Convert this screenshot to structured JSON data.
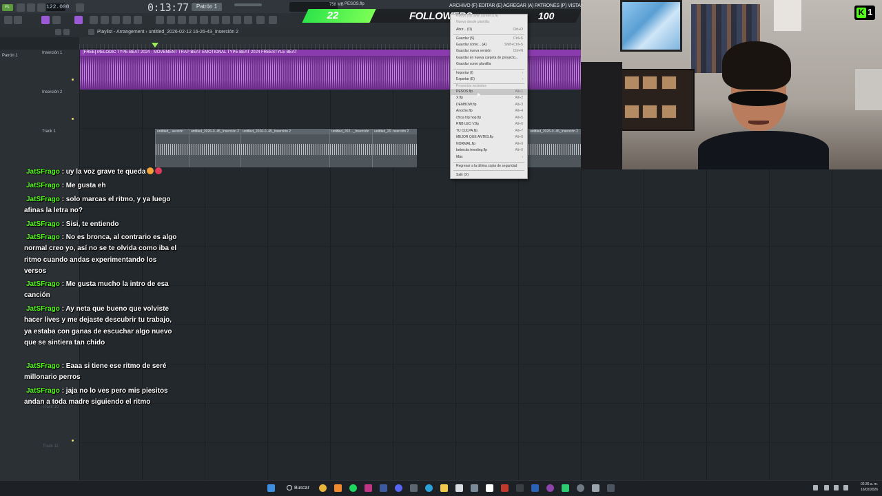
{
  "daw": {
    "bpm": "122.000",
    "time": "0:13:77",
    "pattern": "Patrón 1",
    "project_file": "PESOS.flp",
    "mem": "758 MB",
    "menubar": "ARCHIVO (F) EDITAR (E) AGREGAR (A) PATRONES (P) VISTA (V) OPCIONES (",
    "playlist_title": "Playlist - Arrangement › untitled_2026-02-12 16-26-43_Inserción 2",
    "pattern_picker": "Patrón 1"
  },
  "tracks": [
    {
      "label": "Inserción 1"
    },
    {
      "label": "Inserción 2"
    },
    {
      "label": "Track 1"
    }
  ],
  "ghost_tracks": [
    "Track 10",
    "Track 11"
  ],
  "clips": {
    "purple_title": "[FREE] MELODIC TYPE BEAT 2024 - MOVEMENT TRAP BEAT EMOTIONAL TYPE BEAT 2024 FREESTYLE BEAT",
    "gray": [
      "untitled_..serción",
      "untitled_2026-0..45_Inserción 2",
      "untitled_2026-0..45_Inserción 2",
      "untitled_202..._Inserción",
      "untitled_20..nserción 2",
      "untitled_2026-0..45_Inserción 2"
    ]
  },
  "overlay": {
    "followers_count": "22",
    "followers_label": "FOLLOWERS",
    "followers_goal": "100",
    "kick_count": "1",
    "colors": {
      "bar": "#2ee44a",
      "username": "#53fc18"
    }
  },
  "file_menu": {
    "items": [
      {
        "label": "Nuevo (N) (with screen) (N)",
        "shortcut": "",
        "dim": true
      },
      {
        "label": "Nuevo desde plantilla",
        "shortcut": "",
        "dim": true
      },
      {
        "label": "Abrir... (O)",
        "shortcut": "Ctrl+O"
      },
      {
        "label": "Guardar (S)",
        "shortcut": "Ctrl+S"
      },
      {
        "label": "Guardar como... (A)",
        "shortcut": "Shift+Ctrl+S"
      },
      {
        "label": "Guardar nueva versión",
        "shortcut": "Ctrl+N"
      },
      {
        "label": "Guardar en nueva carpeta de proyecto...",
        "shortcut": ""
      },
      {
        "label": "Guardar como plantilla",
        "shortcut": ""
      },
      {
        "label": "Importar (I)",
        "shortcut": "›"
      },
      {
        "label": "Exportar (E)",
        "shortcut": "›"
      },
      {
        "label": "Proyectos recientes",
        "shortcut": "",
        "dim": true
      },
      {
        "label": "PESOS.flp",
        "shortcut": "Alt+1",
        "hl": true
      },
      {
        "label": "X.flp",
        "shortcut": "Alt+2"
      },
      {
        "label": "DEMBOW.flp",
        "shortcut": "Alt+3"
      },
      {
        "label": "Anoche.flp",
        "shortcut": "Alt+4"
      },
      {
        "label": "chica hip hop.flp",
        "shortcut": "Alt+5"
      },
      {
        "label": "RNB LEO V.flp",
        "shortcut": "Alt+6"
      },
      {
        "label": "TU CULPA.flp",
        "shortcut": "Alt+7"
      },
      {
        "label": "MEJOR QUE ANTES.flp",
        "shortcut": "Alt+8"
      },
      {
        "label": "NORMAL.flp",
        "shortcut": "Alt+9"
      },
      {
        "label": "bebecita trending.flp",
        "shortcut": "Alt+0"
      },
      {
        "label": "Más",
        "shortcut": "›"
      },
      {
        "label": "Regresar a la última copia de seguridad",
        "shortcut": ""
      },
      {
        "label": "Salir (X)",
        "shortcut": ""
      }
    ]
  },
  "chat": [
    {
      "user": "JatSFrago",
      "text": ": uy la voz grave te queda"
    },
    {
      "user": "JatSFrago",
      "text": ": Me gusta eh"
    },
    {
      "user": "JatSFrago",
      "text": ": solo marcas el ritmo, y ya luego afinas la letra no?"
    },
    {
      "user": "JatSFrago",
      "text": ": Sisi, te entiendo"
    },
    {
      "user": "JatSFrago",
      "text": ": No es bronca, al contrario es algo normal creo yo, así no se te olvida como iba el ritmo cuando andas experimentando los versos"
    },
    {
      "user": "JatSFrago",
      "text": ": Me gusta mucho la intro de esa canción"
    },
    {
      "user": "JatSFrago",
      "text": ": Ay neta que bueno que volviste hacer lives y me dejaste descubrir tu trabajo, ya estaba con ganas de escuchar algo nuevo que se sintiera tan chido"
    },
    {
      "user": "JatSFrago",
      "text": ": Eaaa si tiene ese ritmo de seré millonario perros"
    },
    {
      "user": "JatSFrago",
      "text": ": jaja no lo ves pero mis piesitos andan a toda madre siguiendo el ritmo"
    }
  ],
  "taskbar": {
    "search_label": "Buscar",
    "time": "02:36 a. m.",
    "date": "16/02/2026"
  }
}
